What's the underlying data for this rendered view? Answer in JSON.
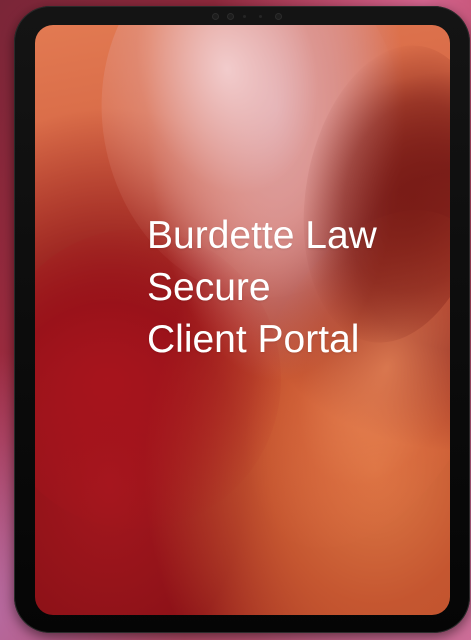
{
  "screen": {
    "title_lines": [
      "Burdette Law",
      "Secure",
      "Client Portal"
    ]
  },
  "device": {
    "camera_icon": "camera-icon",
    "sensor_icon": "sensor-icon"
  },
  "colors": {
    "frame": "#080808",
    "title_text": "#ffffff",
    "accent_red": "#b63b2a"
  }
}
